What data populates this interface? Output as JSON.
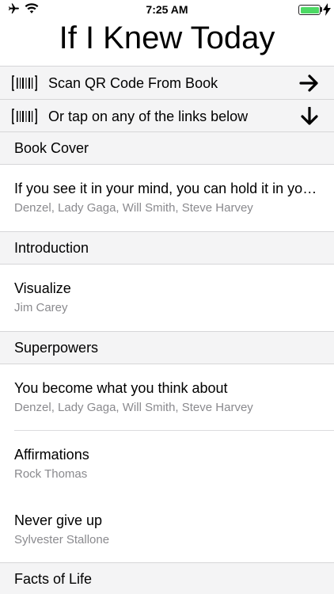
{
  "status_bar": {
    "time": "7:25 AM",
    "icons": [
      "airplane-icon",
      "wifi-icon",
      "battery-icon",
      "charging-bolt-icon"
    ],
    "battery_color": "#4cd964"
  },
  "title": "If I Knew Today",
  "actions": [
    {
      "icon": "barcode-icon",
      "label": "Scan QR Code From Book",
      "arrow": "arrow-right-icon"
    },
    {
      "icon": "barcode-icon",
      "label": "Or tap on any of the links below",
      "arrow": "arrow-down-icon"
    }
  ],
  "sections": [
    {
      "header": "Book Cover",
      "items": [
        {
          "title": "If you see it in your mind, you can hold it in your hand",
          "subtitle": "Denzel, Lady Gaga, Will Smith, Steve Harvey"
        }
      ]
    },
    {
      "header": "Introduction",
      "items": [
        {
          "title": "Visualize",
          "subtitle": "Jim Carey"
        }
      ]
    },
    {
      "header": "Superpowers",
      "items": [
        {
          "title": "You become what you think about",
          "subtitle": "Denzel, Lady Gaga, Will Smith, Steve Harvey"
        },
        {
          "title": "Affirmations",
          "subtitle": "Rock Thomas"
        },
        {
          "title": "Never give up",
          "subtitle": "Sylvester Stallone"
        }
      ]
    },
    {
      "header": "Facts of Life",
      "items": []
    }
  ]
}
